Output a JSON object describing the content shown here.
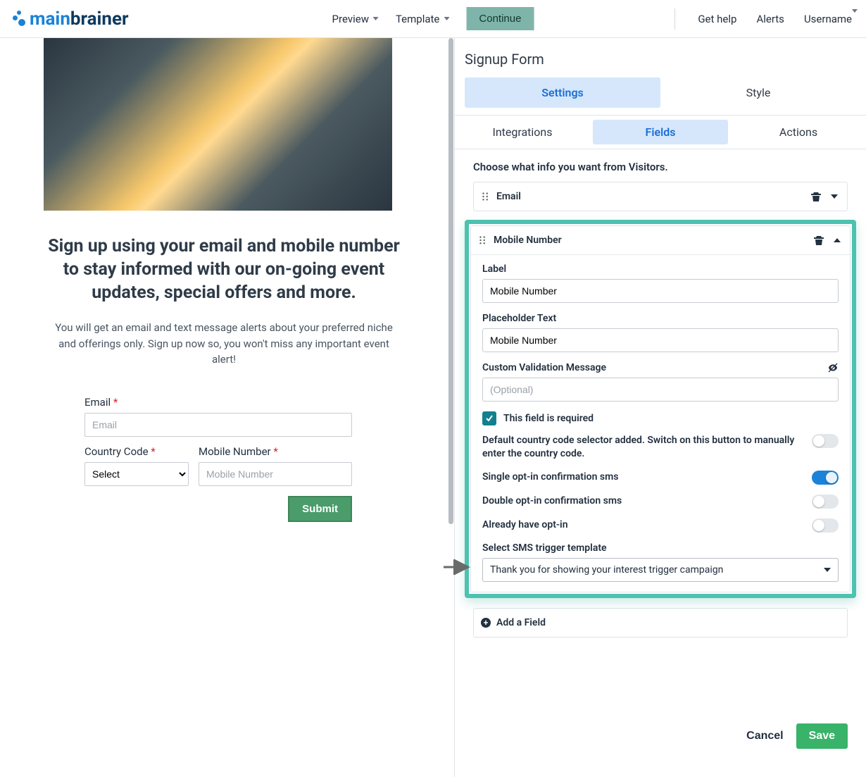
{
  "topbar": {
    "logo_main": "main",
    "logo_brainer": "brainer",
    "preview": "Preview",
    "template": "Template",
    "continue": "Continue",
    "help": "Get help",
    "alerts": "Alerts",
    "username": "Username"
  },
  "preview": {
    "headline": "Sign up using your email and mobile number to stay informed with our on-going event updates, special offers and more.",
    "subline": "You will get an email and text message alerts about your preferred niche and offerings only. Sign up now so, you won't miss any important event alert!",
    "email_label": "Email",
    "email_placeholder": "Email",
    "cc_label": "Country Code",
    "cc_select": "Select",
    "mobile_label": "Mobile Number",
    "mobile_placeholder": "Mobile Number",
    "submit": "Submit",
    "star": "*"
  },
  "panel": {
    "title": "Signup Form",
    "tabs1": {
      "settings": "Settings",
      "style": "Style"
    },
    "tabs2": {
      "integrations": "Integrations",
      "fields": "Fields",
      "actions": "Actions"
    },
    "hint": "Choose what info you want from Visitors.",
    "email_field": "Email",
    "mobile_field": {
      "title": "Mobile Number",
      "label_caption": "Label",
      "label_value": "Mobile Number",
      "placeholder_caption": "Placeholder Text",
      "placeholder_value": "Mobile Number",
      "validation_caption": "Custom Validation Message",
      "validation_placeholder": "(Optional)",
      "required": "This field is required",
      "default_cc": "Default country code selector added. Switch on this button to manually enter the country code.",
      "single_optin": "Single opt-in confirmation sms",
      "double_optin": "Double opt-in confirmation sms",
      "already_optin": "Already have opt-in",
      "trigger_caption": "Select SMS trigger template",
      "trigger_value": "Thank you for showing your interest trigger campaign"
    },
    "add_field": "Add a Field",
    "cancel": "Cancel",
    "save": "Save"
  }
}
